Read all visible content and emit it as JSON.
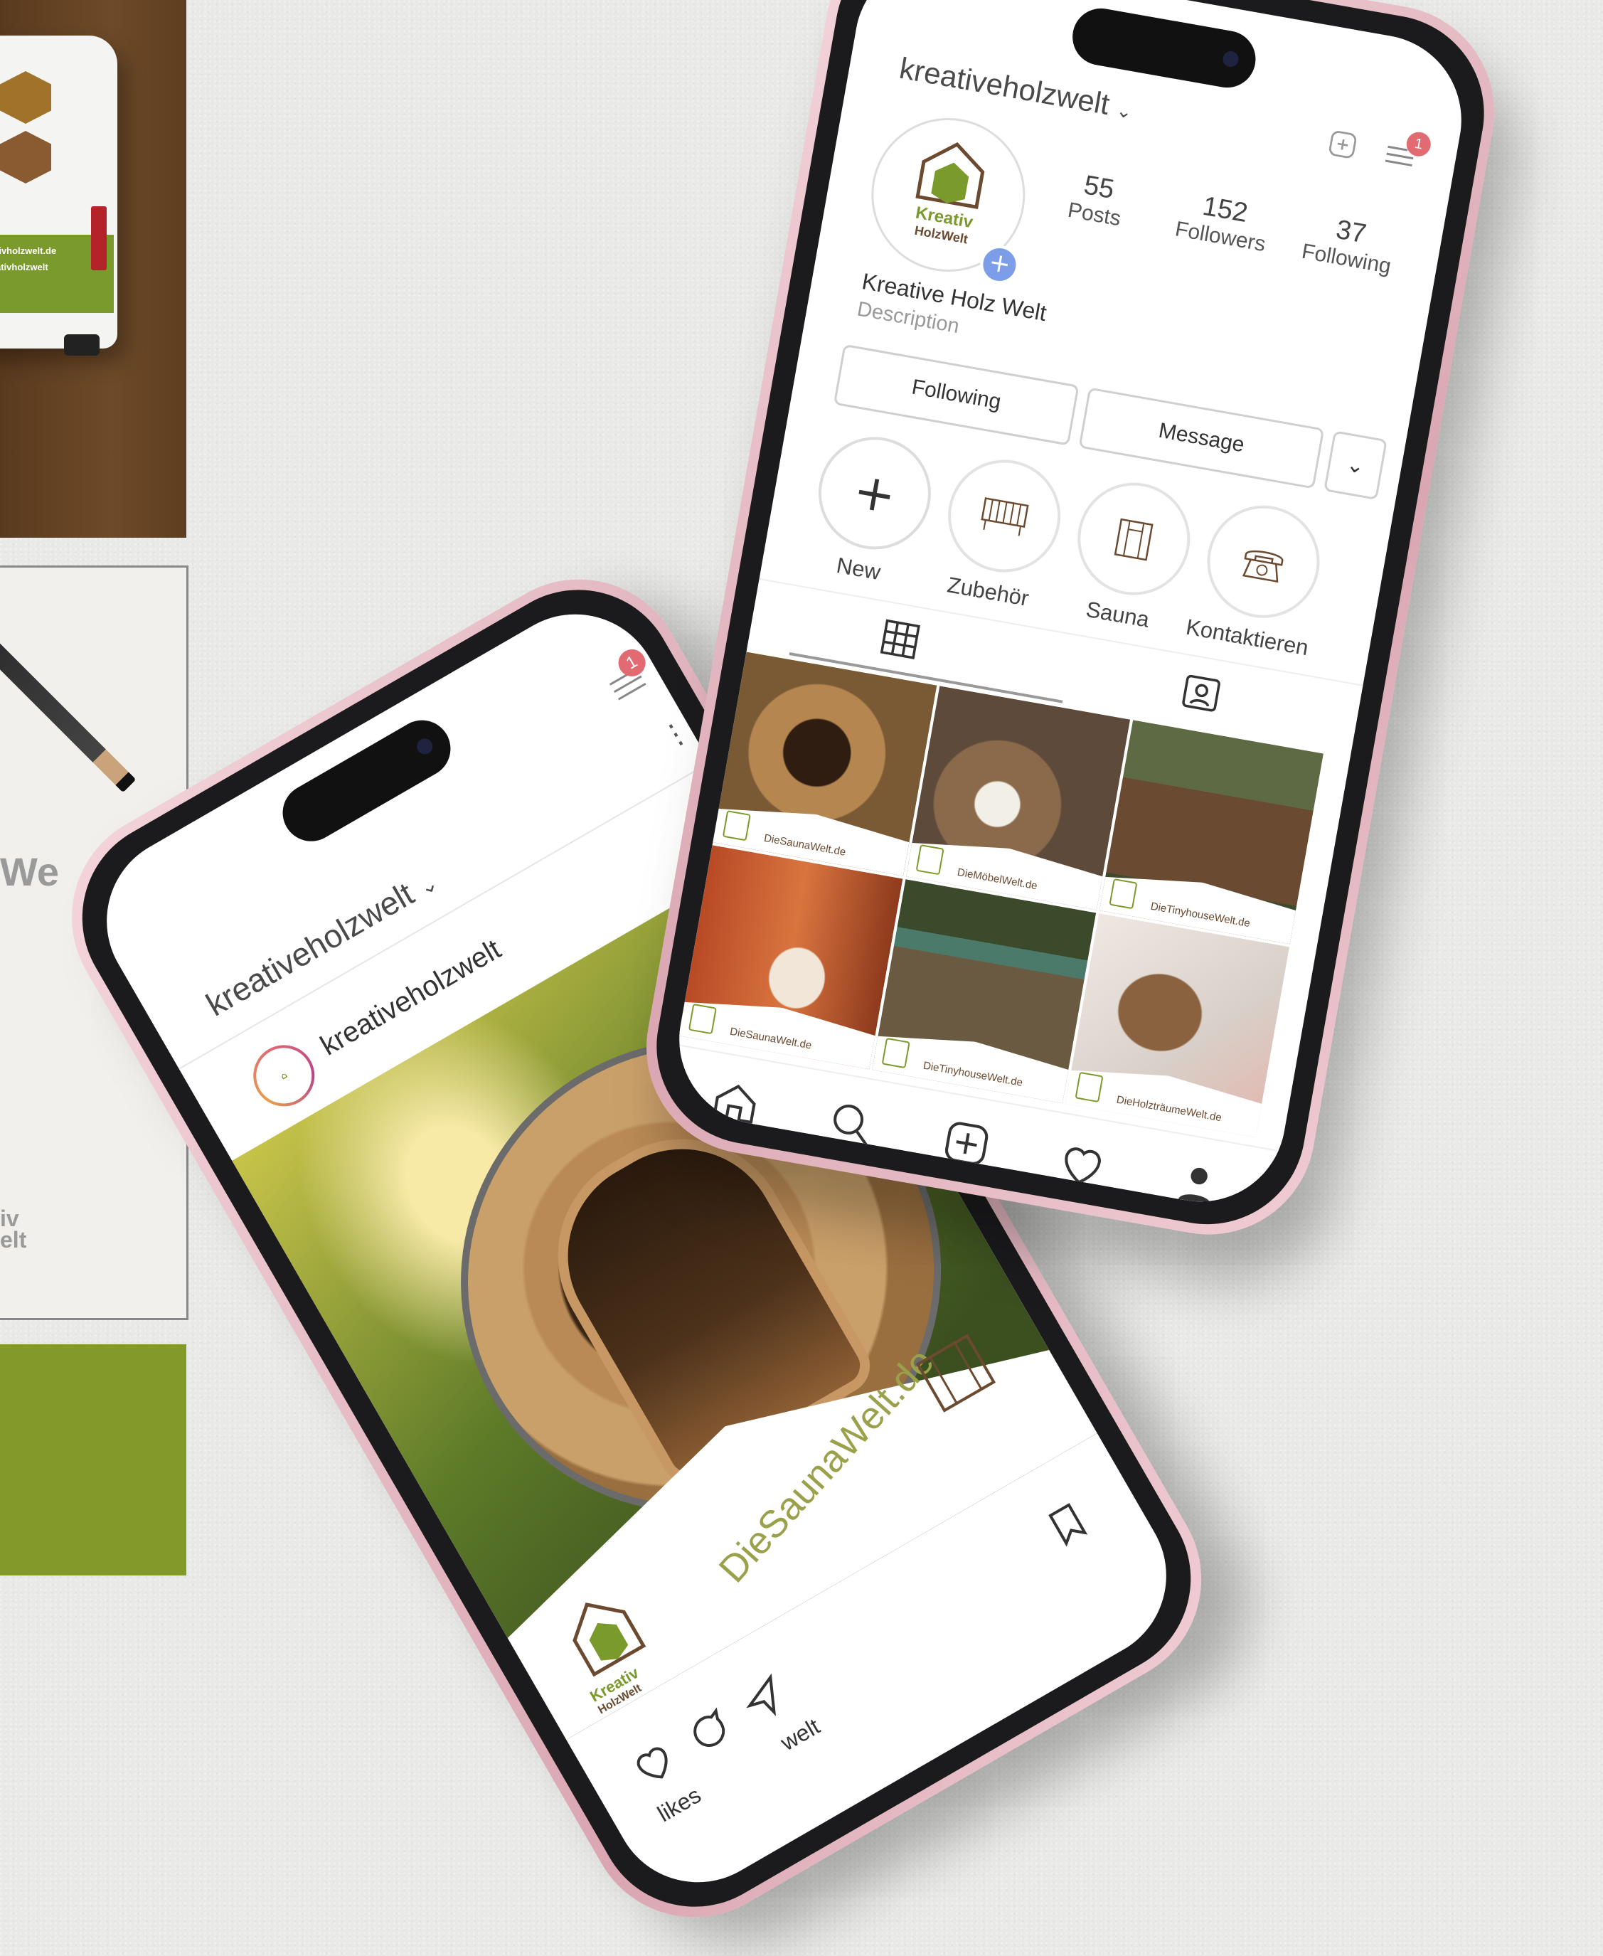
{
  "van": {
    "website": "tivholzwelt.de",
    "instagram": "ativholzwelt"
  },
  "paper": {
    "fragment_top": "We",
    "fragment_logo_1": "iv",
    "fragment_logo_2": "elt"
  },
  "profile_phone": {
    "username": "kreativeholzwelt",
    "notification_count": "1",
    "logo_line1": "Kreativ",
    "logo_line2": "HolzWelt",
    "stats": [
      {
        "value": "55",
        "label": "Posts"
      },
      {
        "value": "152",
        "label": "Followers"
      },
      {
        "value": "37",
        "label": "Following"
      }
    ],
    "display_name": "Kreative Holz Welt",
    "description": "Description",
    "buttons": {
      "following": "Following",
      "message": "Message"
    },
    "highlights": [
      {
        "label": "New",
        "icon": "plus-icon"
      },
      {
        "label": "Zubehör",
        "icon": "bench-icon"
      },
      {
        "label": "Sauna",
        "icon": "sauna-icon"
      },
      {
        "label": "Kontaktieren",
        "icon": "telephone-icon"
      }
    ],
    "tabs": [
      "grid-icon",
      "tagged-icon"
    ],
    "grid": [
      {
        "brand": "DieSaunaWelt.de",
        "color": "#7a5a35",
        "tone": "#c9a15a"
      },
      {
        "brand": "DieMöbelWelt.de",
        "color": "#6b5a48",
        "tone": "#a8927a"
      },
      {
        "brand": "DieTinyhouseWelt.de",
        "color": "#4a3a2c",
        "tone": "#6d7a52"
      },
      {
        "brand": "DieSaunaWelt.de",
        "color": "#8a3b22",
        "tone": "#c4653a"
      },
      {
        "brand": "DieTinyhouseWelt.de",
        "color": "#3f4a34",
        "tone": "#7a6a52"
      },
      {
        "brand": "DieHolzträumeWelt.de",
        "color": "#8a6848",
        "tone": "#d9cfc5"
      }
    ],
    "bottom_nav": [
      "home-icon",
      "search-icon",
      "add-post-icon",
      "heart-icon",
      "profile-icon"
    ]
  },
  "post_phone": {
    "username": "kreativeholzwelt",
    "notification_count": "1",
    "post_author": "kreativeholzwelt",
    "brand": "DieSaunaWelt.de",
    "logo_line1": "Kreativ",
    "logo_line2": "HolzWelt",
    "likes_fragment": "likes",
    "caption_fragment": "welt"
  },
  "colors": {
    "brand_green": "#7b9a2c",
    "brand_brown": "#6b4a30",
    "badge_red": "#e26b73",
    "phone_pink": "#e8bcc6"
  }
}
